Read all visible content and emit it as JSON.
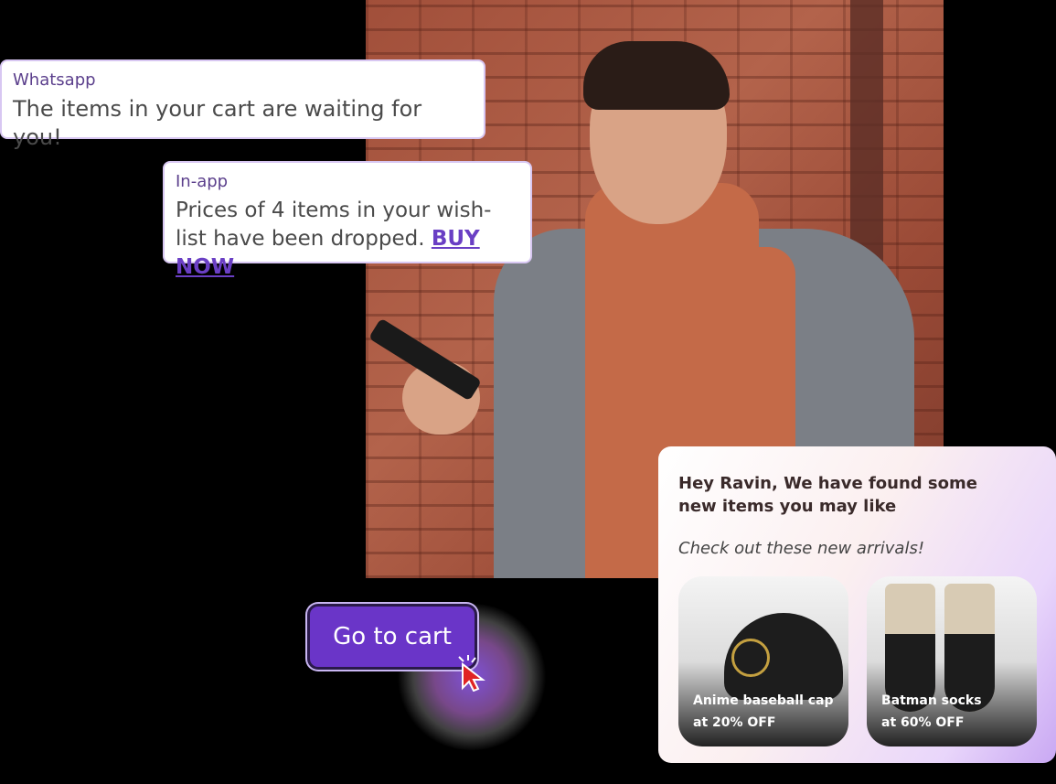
{
  "notifications": {
    "whatsapp": {
      "channel": "Whatsapp",
      "message": "The items in your cart are waiting for you!"
    },
    "inapp": {
      "channel": "In-app",
      "message": "Prices of 4 items in your wish-list have been dropped.",
      "link": "BUY NOW"
    }
  },
  "cart_button": {
    "label": "Go to cart"
  },
  "recommendation": {
    "title": "Hey Ravin, We have found some new items you may like",
    "subtitle": "Check out these new arrivals!",
    "products": [
      {
        "name": "Anime baseball cap",
        "discount": "at 20% OFF"
      },
      {
        "name": "Batman socks",
        "discount": "at 60% OFF"
      }
    ]
  },
  "colors": {
    "accent": "#6a35c8",
    "link": "#6a3fc4",
    "tag": "#5b3f8c"
  }
}
